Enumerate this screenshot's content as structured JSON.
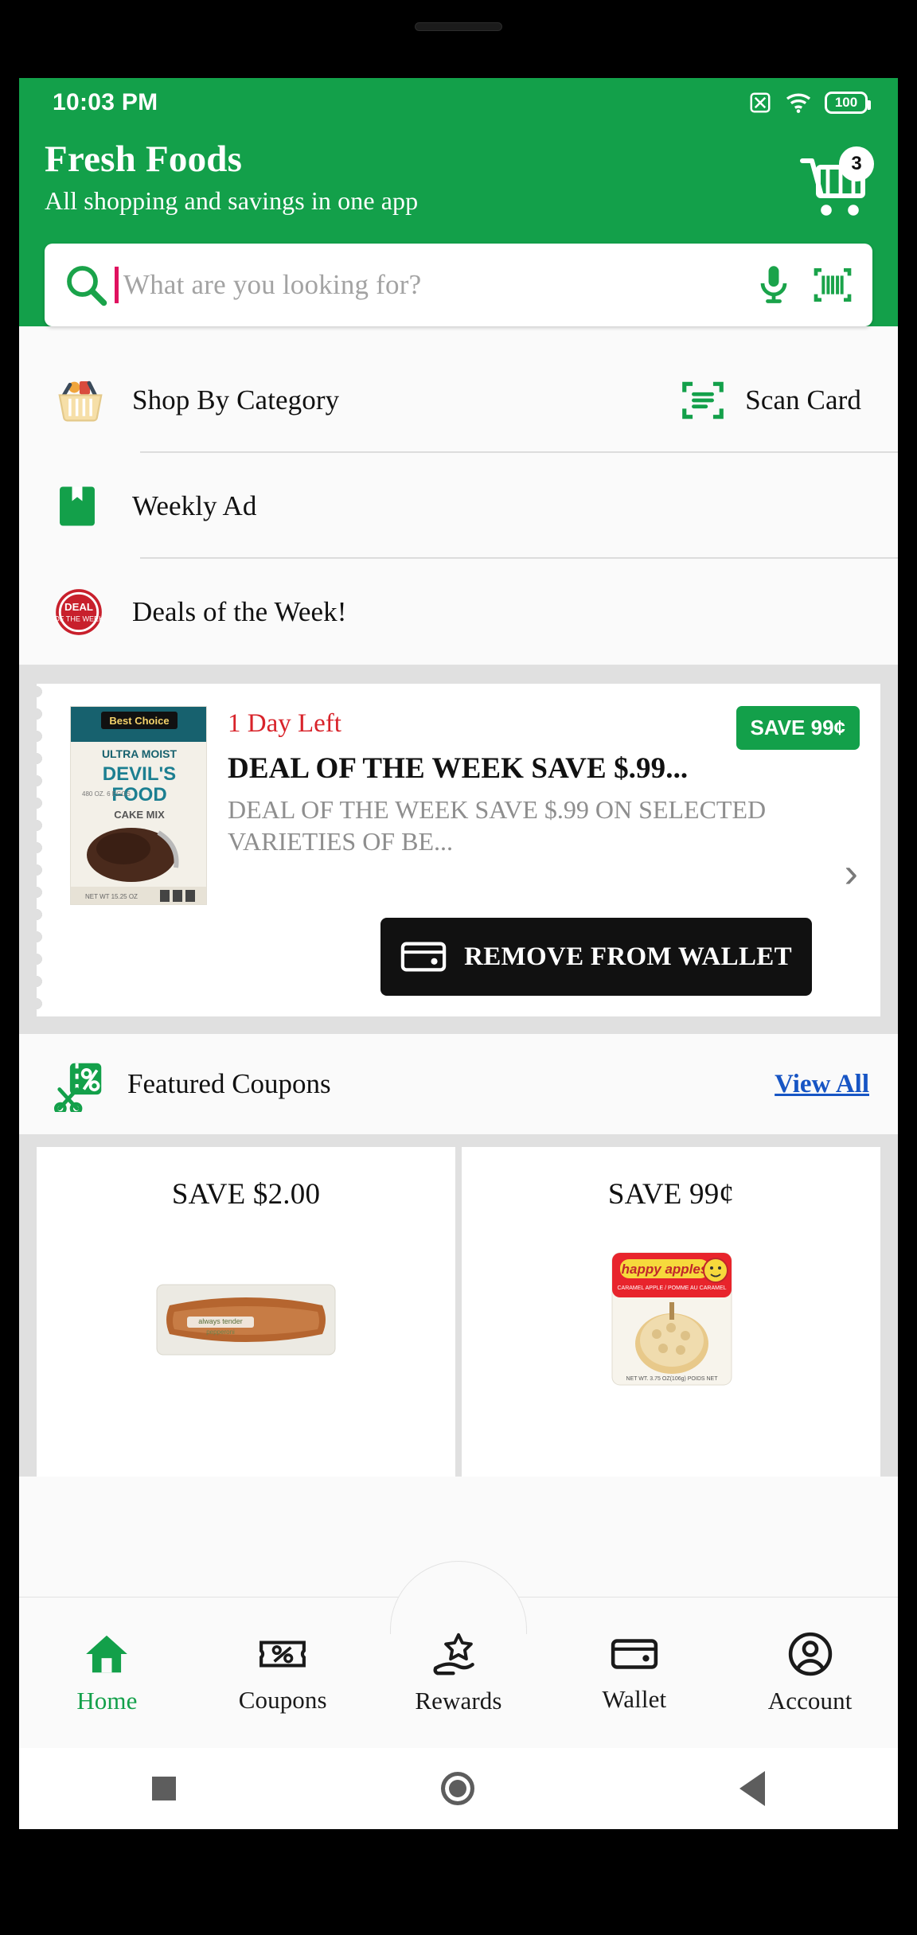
{
  "status_bar": {
    "time": "10:03 PM",
    "battery_level": "100",
    "icons": [
      "no-sim-icon",
      "wifi-icon",
      "battery-icon"
    ]
  },
  "header": {
    "title": "Fresh Foods",
    "subtitle": "All shopping and savings in one app",
    "cart_icon": "shopping-cart-icon",
    "cart_badge_count": "3",
    "background_color": "#13a04a"
  },
  "search": {
    "placeholder": "What are you looking for?",
    "value": "",
    "search_icon": "search-icon",
    "mic_icon": "microphone-icon",
    "barcode_icon": "barcode-scan-icon"
  },
  "menu": {
    "rows": [
      {
        "label": "Shop By Category",
        "icon": "shopping-basket-icon"
      },
      {
        "label": "Weekly Ad",
        "icon": "book-icon"
      },
      {
        "label": "Deals of the Week!",
        "icon": "deal-of-the-week-badge-icon"
      }
    ],
    "scan_card": {
      "label": "Scan Card",
      "icon": "scan-card-icon"
    }
  },
  "deal": {
    "days_left": "1 Day Left",
    "save_badge": "SAVE 99¢",
    "title": "DEAL OF THE WEEK SAVE $.99...",
    "description": "DEAL OF THE WEEK SAVE $.99 ON SELECTED VARIETIES OF BE...",
    "button_label": "REMOVE FROM WALLET",
    "button_icon": "wallet-icon",
    "chevron": "›",
    "product": {
      "brand": "Best Choice",
      "line1": "ULTRA MOIST",
      "line2": "DEVIL'S",
      "line3": "FOOD",
      "line4": "CAKE MIX",
      "weight": "480 OZ. 6 EGGS"
    }
  },
  "featured": {
    "title": "Featured Coupons",
    "icon": "coupon-scissors-icon",
    "view_all": "View All"
  },
  "coupons": [
    {
      "save": "SAVE $2.00",
      "product": "pepperoni-package",
      "brand": "always tender pepperoni"
    },
    {
      "save": "SAVE 99¢",
      "product": "happy-apples-caramel",
      "brand": "happy apples"
    }
  ],
  "bottom_nav": [
    {
      "label": "Home",
      "icon": "home-icon",
      "active": true
    },
    {
      "label": "Coupons",
      "icon": "coupon-icon",
      "active": false
    },
    {
      "label": "Rewards",
      "icon": "rewards-icon",
      "active": false
    },
    {
      "label": "Wallet",
      "icon": "wallet-icon",
      "active": false
    },
    {
      "label": "Account",
      "icon": "account-icon",
      "active": false
    }
  ],
  "system_nav": {
    "recents": "square-icon",
    "home": "circle-icon",
    "back": "triangle-back-icon"
  },
  "colors": {
    "brand_green": "#13a04a",
    "red": "#d8232a",
    "link_blue": "#1755c4"
  }
}
